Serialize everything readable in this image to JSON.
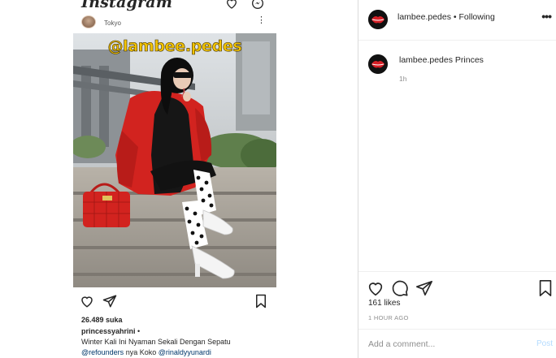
{
  "post_screenshot": {
    "app_name": "Instagram",
    "location": "Tokyo",
    "watermark": "@lambee.pedes",
    "likes": "26.489 suka",
    "caption_user": "princessyahrini",
    "caption_sep": "•",
    "caption_text": "Winter Kali Ini Nyaman Sekali Dengan Sepatu",
    "caption_tag1": "@refounders",
    "caption_mid": "nya Koko",
    "caption_tag2": "@rinaldyyunardi"
  },
  "header": {
    "username": "lambee.pedes",
    "separator": "•",
    "follow_status": "Following",
    "more_label": "•••"
  },
  "comment": {
    "username": "lambee.pedes",
    "text": "Princes",
    "time": "1h"
  },
  "actions": {
    "likes": "161 likes",
    "time_ago": "1 HOUR AGO"
  },
  "comment_box": {
    "placeholder": "Add a comment...",
    "post_label": "Post"
  },
  "colors": {
    "watermark": "#f3c400",
    "coat": "#d2231f",
    "link": "#00376b",
    "post_disabled": "#b3dbff"
  },
  "icons": [
    "messenger-icon",
    "heart-icon",
    "comment-icon",
    "share-icon",
    "bookmark-icon",
    "more-icon"
  ]
}
